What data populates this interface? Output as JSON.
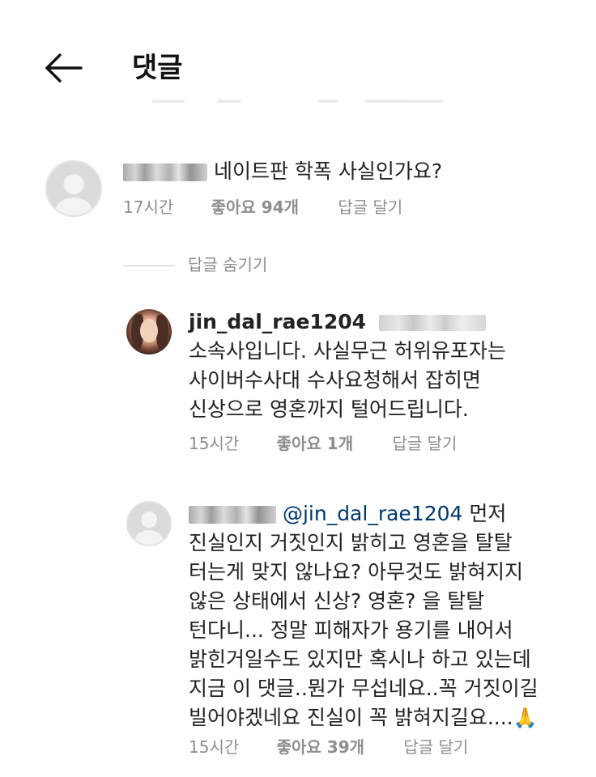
{
  "header": {
    "title": "댓글",
    "back_icon": "arrow-left-icon"
  },
  "comments": [
    {
      "text": "네이트판 학폭 사실인가요?",
      "time": "17시간",
      "likes": "좋아요 94개",
      "reply": "답글 달기"
    }
  ],
  "hide_replies": "답글 숨기기",
  "replies": [
    {
      "username": "jin_dal_rae1204",
      "lines": [
        "소속사입니다. 사실무근 허위유포자는",
        "사이버수사대 수사요청해서 잡히면",
        "신상으로 영혼까지 털어드립니다."
      ],
      "time": "15시간",
      "likes": "좋아요 1개",
      "reply": "답글 달기"
    },
    {
      "mention": "@jin_dal_rae1204",
      "first_line_rest": " 먼저",
      "lines": [
        "진실인지 거짓인지 밝히고 영혼을 탈탈",
        "터는게 맞지 않나요? 아무것도 밝혀지지",
        "않은 상태에서 신상? 영혼? 을 탈탈",
        "턴다니... 정말 피해자가 용기를 내어서",
        "밝힌거일수도 있지만 혹시나 하고 있는데",
        "지금 이 댓글..뭔가 무섭네요..꼭 거짓이길",
        "빌어야겠네요 진실이 꼭 밝혀지길요...."
      ],
      "emoji": "🙏",
      "time": "15시간",
      "likes": "좋아요 39개",
      "reply": "답글 달기"
    }
  ]
}
